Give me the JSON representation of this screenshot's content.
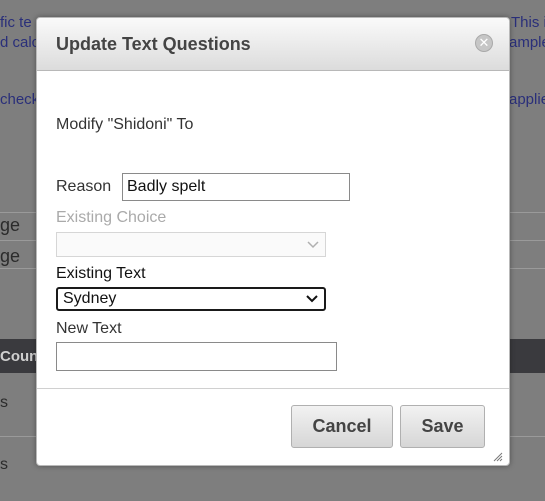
{
  "background": {
    "snippets": [
      "fic te",
      "d calc",
      "check",
      "This is",
      "ample",
      "applie",
      "ge",
      "ge",
      "Count",
      "s",
      "s"
    ]
  },
  "dialog": {
    "title": "Update Text Questions",
    "close_glyph": "✕",
    "modify_text": "Modify \"Shidoni\" To",
    "reason": {
      "label": "Reason",
      "value": "Badly spelt"
    },
    "existing_choice": {
      "label": "Existing Choice",
      "value": ""
    },
    "existing_text": {
      "label": "Existing Text",
      "value": "Sydney"
    },
    "new_text": {
      "label": "New Text",
      "value": ""
    },
    "buttons": {
      "cancel": "Cancel",
      "save": "Save"
    }
  }
}
